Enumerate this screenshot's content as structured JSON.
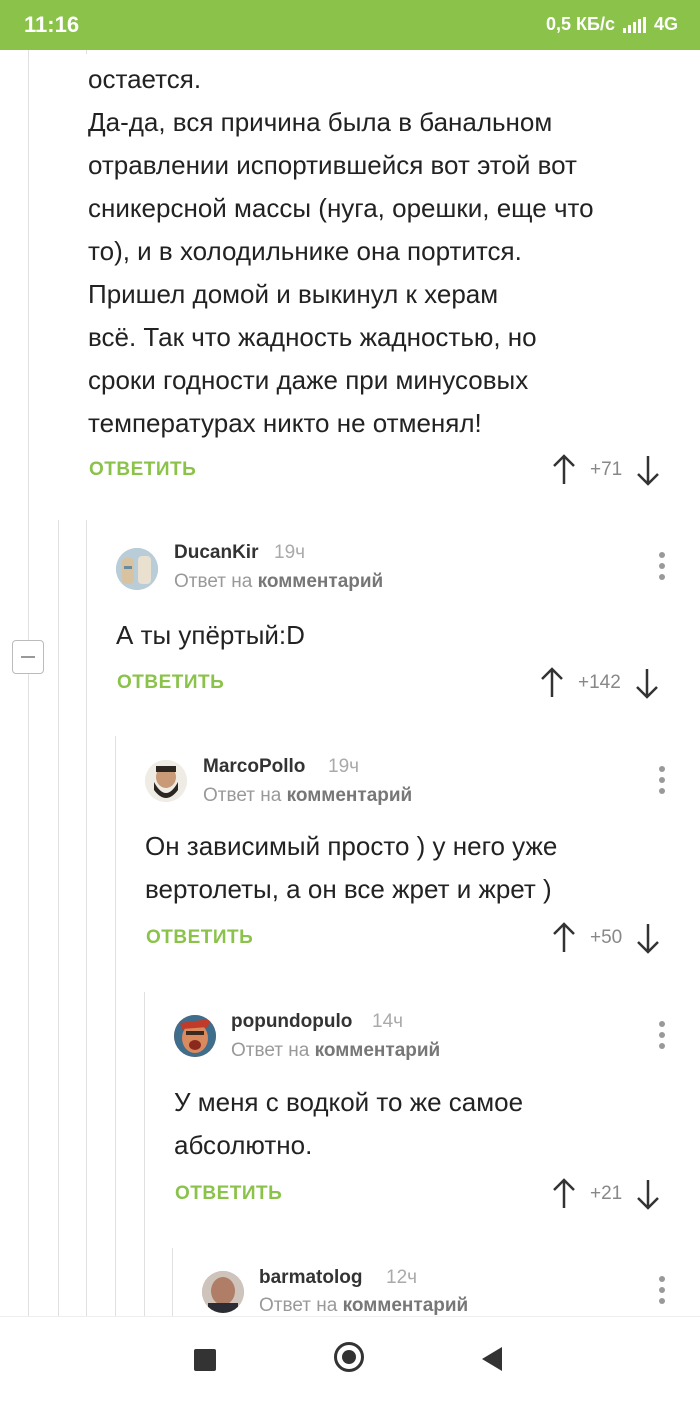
{
  "status_bar": {
    "time": "11:16",
    "speed": "0,5 КБ/с",
    "network": "4G"
  },
  "comments": [
    {
      "text_lines": [
        "остается.",
        "Да-да, вся причина была в банальном",
        "отравлении испортившейся вот этой вот",
        "сникерсной массы (нуга, орешки, еще что",
        "то), и в холодильнике она портится.",
        "Пришел домой и выкинул к херам",
        "всё. Так что жадность жадностью, но",
        "сроки годности даже при минусовых",
        "температурах никто не отменял!"
      ],
      "reply_label": "ОТВЕТИТЬ",
      "score": "+71"
    },
    {
      "author": "DucanKir",
      "time": "19ч",
      "reply_to_prefix": "Ответ на",
      "reply_to_link": "комментарий",
      "text_lines": [
        "А ты упёртый:D"
      ],
      "reply_label": "ОТВЕТИТЬ",
      "score": "+142"
    },
    {
      "author": "MarcoPollo",
      "time": "19ч",
      "reply_to_prefix": "Ответ на",
      "reply_to_link": "комментарий",
      "text_lines": [
        "Он зависимый просто ) у него уже",
        "вертолеты, а он все жрет и жрет )"
      ],
      "reply_label": "ОТВЕТИТЬ",
      "score": "+50"
    },
    {
      "author": "popundopulo",
      "time": "14ч",
      "reply_to_prefix": "Ответ на",
      "reply_to_link": "комментарий",
      "text_lines": [
        "У меня с водкой то же самое",
        "абсолютно."
      ],
      "reply_label": "ОТВЕТИТЬ",
      "score": "+21"
    },
    {
      "author": "barmatolog",
      "time": "12ч",
      "reply_to_prefix": "Ответ на",
      "reply_to_link": "комментарий"
    }
  ],
  "icons": {
    "upvote": "arrow-up-icon",
    "downvote": "arrow-down-icon",
    "menu": "more-vertical-icon",
    "collapse": "collapse-thread-icon",
    "nav_recent": "square-icon",
    "nav_home": "circle-icon",
    "nav_back": "triangle-back-icon"
  },
  "colors": {
    "accent": "#8ac24a",
    "text": "#222222",
    "muted": "#999999"
  }
}
